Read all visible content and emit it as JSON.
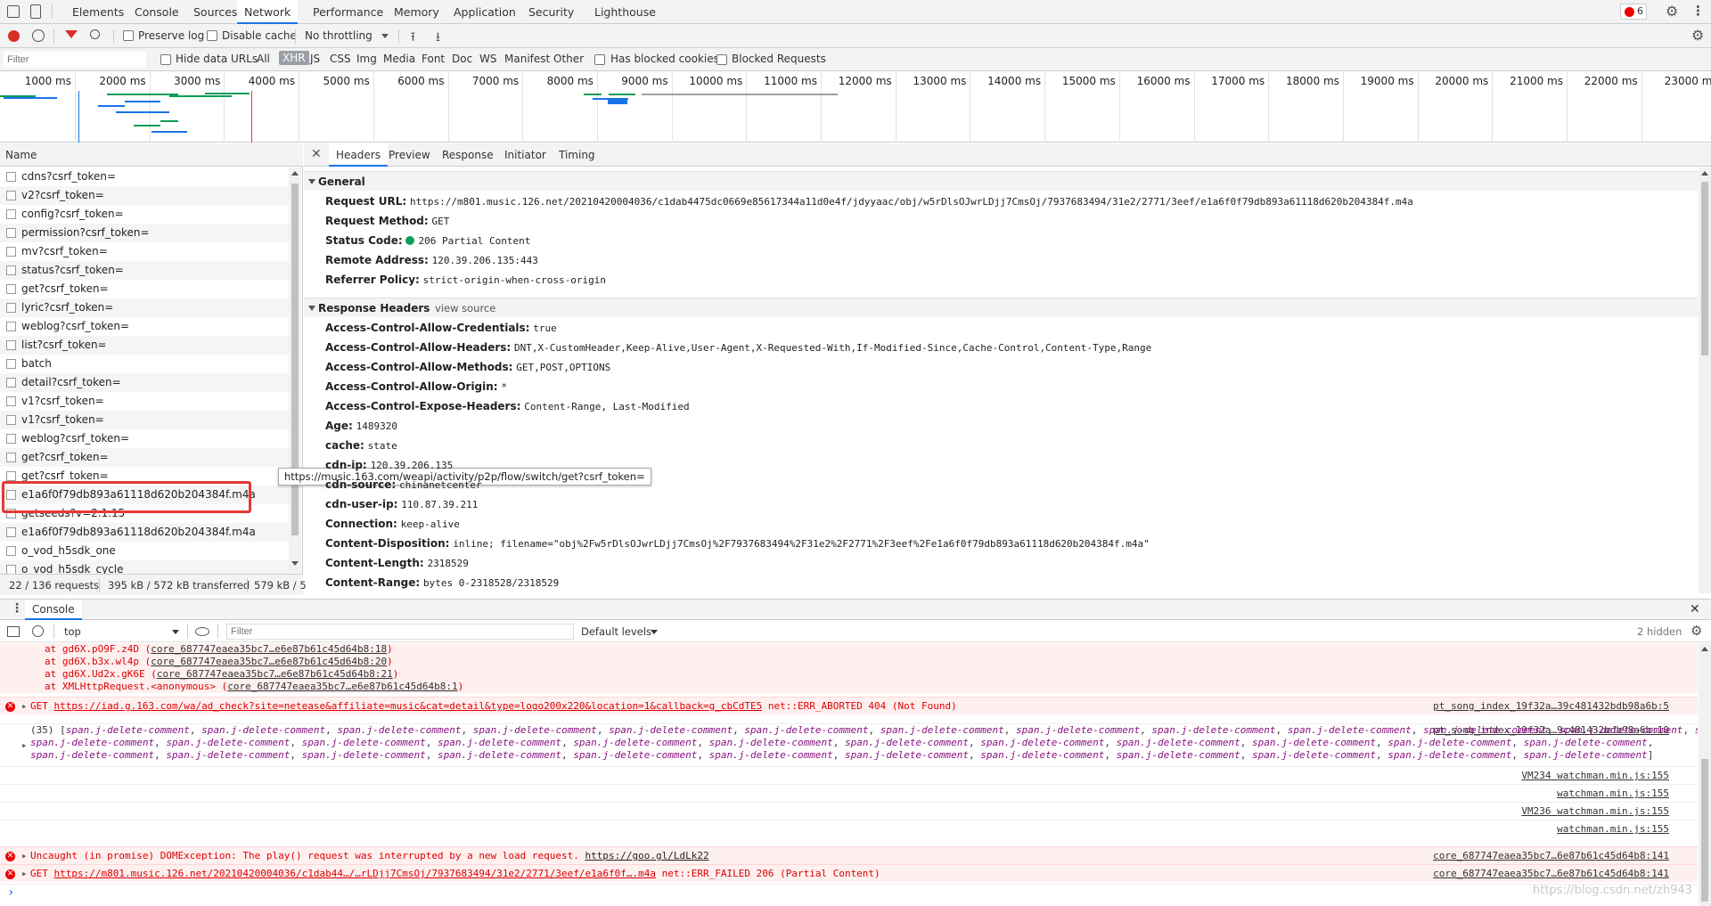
{
  "tabs": [
    {
      "label": "Elements"
    },
    {
      "label": "Console"
    },
    {
      "label": "Sources"
    },
    {
      "label": "Network"
    },
    {
      "label": "Performance"
    },
    {
      "label": "Memory"
    },
    {
      "label": "Application"
    },
    {
      "label": "Security"
    },
    {
      "label": "Lighthouse"
    }
  ],
  "error_count": "6",
  "toolbar": {
    "preserve_log": "Preserve log",
    "disable_cache": "Disable cache",
    "throttling": "No throttling"
  },
  "filterbar": {
    "placeholder": "Filter",
    "hide_data_urls": "Hide data URLs",
    "types": [
      "All",
      "XHR",
      "JS",
      "CSS",
      "Img",
      "Media",
      "Font",
      "Doc",
      "WS",
      "Manifest",
      "Other"
    ],
    "has_blocked_cookies": "Has blocked cookies",
    "blocked_requests": "Blocked Requests"
  },
  "timeline_ticks": [
    "1000 ms",
    "2000 ms",
    "3000 ms",
    "4000 ms",
    "5000 ms",
    "6000 ms",
    "7000 ms",
    "8000 ms",
    "9000 ms",
    "10000 ms",
    "11000 ms",
    "12000 ms",
    "13000 ms",
    "14000 ms",
    "15000 ms",
    "16000 ms",
    "17000 ms",
    "18000 ms",
    "19000 ms",
    "20000 ms",
    "21000 ms",
    "22000 ms",
    "23000 m"
  ],
  "list_header": "Name",
  "requests": [
    "cdns?csrf_token=",
    "v2?csrf_token=",
    "config?csrf_token=",
    "permission?csrf_token=",
    "mv?csrf_token=",
    "status?csrf_token=",
    "get?csrf_token=",
    "lyric?csrf_token=",
    "weblog?csrf_token=",
    "list?csrf_token=",
    "batch",
    "detail?csrf_token=",
    "v1?csrf_token=",
    "v1?csrf_token=",
    "weblog?csrf_token=",
    "get?csrf_token=",
    "get?csrf_token=",
    "e1a6f0f79db893a61118d620b204384f.m4a",
    "getseeds?v=2.1.15",
    "e1a6f0f79db893a61118d620b204384f.m4a",
    "o_vod_h5sdk_one",
    "o_vod_h5sdk_cycle"
  ],
  "tooltip": "https://music.163.com/weapi/activity/p2p/flow/switch/get?csrf_token=",
  "summary": {
    "requests": "22 / 136 requests",
    "transferred": "395 kB / 572 kB transferred",
    "resources": "579 kB / 5"
  },
  "detail_tabs": [
    "Headers",
    "Preview",
    "Response",
    "Initiator",
    "Timing"
  ],
  "general": {
    "title": "General",
    "items": [
      {
        "k": "Request URL:",
        "v": "https://m801.music.126.net/20210420004036/c1dab4475dc0669e85617344a11d0e4f/jdyyaac/obj/w5rDlsOJwrLDjj7CmsOj/7937683494/31e2/2771/3eef/e1a6f0f79db893a61118d620b204384f.m4a"
      },
      {
        "k": "Request Method:",
        "v": "GET"
      },
      {
        "k": "Status Code:",
        "v": "206 Partial Content"
      },
      {
        "k": "Remote Address:",
        "v": "120.39.206.135:443"
      },
      {
        "k": "Referrer Policy:",
        "v": "strict-origin-when-cross-origin"
      }
    ]
  },
  "response_headers": {
    "title": "Response Headers",
    "view_source": "view source",
    "items": [
      {
        "k": "Access-Control-Allow-Credentials:",
        "v": "true"
      },
      {
        "k": "Access-Control-Allow-Headers:",
        "v": "DNT,X-CustomHeader,Keep-Alive,User-Agent,X-Requested-With,If-Modified-Since,Cache-Control,Content-Type,Range"
      },
      {
        "k": "Access-Control-Allow-Methods:",
        "v": "GET,POST,OPTIONS"
      },
      {
        "k": "Access-Control-Allow-Origin:",
        "v": "*"
      },
      {
        "k": "Access-Control-Expose-Headers:",
        "v": "Content-Range, Last-Modified"
      },
      {
        "k": "Age:",
        "v": "1489320"
      },
      {
        "k": "cache:",
        "v": "state"
      },
      {
        "k": "cdn-ip:",
        "v": "120.39.206.135"
      },
      {
        "k": "cdn-source:",
        "v": "chinanetcenter"
      },
      {
        "k": "cdn-user-ip:",
        "v": "110.87.39.211"
      },
      {
        "k": "Connection:",
        "v": "keep-alive"
      },
      {
        "k": "Content-Disposition:",
        "v": "inline; filename=\"obj%2Fw5rDlsOJwrLDjj7CmsOj%2F7937683494%2F31e2%2F2771%2F3eef%2Fe1a6f0f79db893a61118d620b204384f.m4a\""
      },
      {
        "k": "Content-Length:",
        "v": "2318529"
      },
      {
        "k": "Content-Range:",
        "v": "bytes 0-2318528/2318529"
      }
    ]
  },
  "console": {
    "drawer_tab": "Console",
    "context": "top",
    "filter_placeholder": "Filter",
    "levels": "Default levels",
    "hidden": "2 hidden",
    "stack": [
      {
        "pre": "at gd6X.pO9F.z4D (",
        "link": "core_687747eaea35bc7…e6e87b61c45d64b8:18",
        "post": ")"
      },
      {
        "pre": "at gd6X.b3x.wl4p (",
        "link": "core_687747eaea35bc7…e6e87b61c45d64b8:20",
        "post": ")"
      },
      {
        "pre": "at gd6X.Ud2x.gK6E (",
        "link": "core_687747eaea35bc7…e6e87b61c45d64b8:21",
        "post": ")"
      },
      {
        "pre": "at XMLHttpRequest.<anonymous> (",
        "link": "core_687747eaea35bc7…e6e87b61c45d64b8:1",
        "post": ")"
      }
    ],
    "err1": {
      "method": "GET",
      "url": "https://iad.g.163.com/wa/ad_check?site=netease&affiliate=music&cat=detail&type=logo200x220&location=1&callback=g_cbCdTE5",
      "msg": "net::ERR_ABORTED 404 (Not Found)",
      "src": "pt_song_index_19f32a…39c481432bdb98a6b:5"
    },
    "log_src": "pt_song_index_19f32a…9c481432bdb98a6b:10",
    "log_count": "(35)",
    "log_item": "span.j-delete-comment",
    "log_lines": [
      22,
      12,
      12
    ],
    "watch": [
      {
        "pre": "VM234",
        "name": "watchman.min.js:155"
      },
      {
        "pre": "",
        "name": "watchman.min.js:155"
      },
      {
        "pre": "VM236",
        "name": "watchman.min.js:155"
      },
      {
        "pre": "",
        "name": "watchman.min.js:155"
      }
    ],
    "err2": {
      "text": "Uncaught (in promise) DOMException: The play() request was interrupted by a new load request.",
      "link": "https://goo.gl/LdLk22",
      "src": "core_687747eaea35bc7…6e87b61c45d64b8:141"
    },
    "err3": {
      "method": "GET",
      "url": "https://m801.music.126.net/20210420004036/c1dab44…/…rLDjj7CmsOj/7937683494/31e2/2771/3eef/e1a6f0f….m4a",
      "msg": "net::ERR_FAILED 206 (Partial Content)",
      "src": "core_687747eaea35bc7…6e87b61c45d64b8:141"
    },
    "prompt": "›"
  },
  "watermark": "https://blog.csdn.net/zh943",
  "colors": {
    "accent": "#1a73e8",
    "error": "#dd0000",
    "highlight": "#e53935"
  }
}
